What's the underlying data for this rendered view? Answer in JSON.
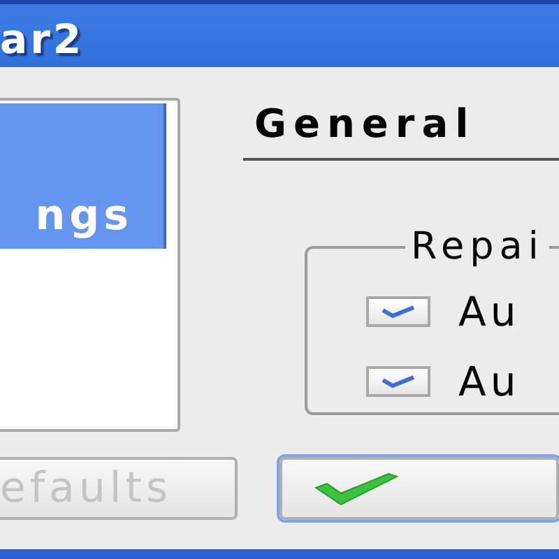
{
  "window": {
    "title": "ar2"
  },
  "sidebar": {
    "items": [
      {
        "label": "ngs",
        "selected": true
      }
    ]
  },
  "panel": {
    "heading": "General",
    "group": {
      "title": "Repai",
      "options": [
        {
          "label": "Au",
          "checked": true
        },
        {
          "label": "Au",
          "checked": true
        }
      ]
    }
  },
  "buttons": [
    {
      "kind": "text",
      "label": "efaults",
      "disabled": true
    },
    {
      "kind": "icon"
    }
  ]
}
